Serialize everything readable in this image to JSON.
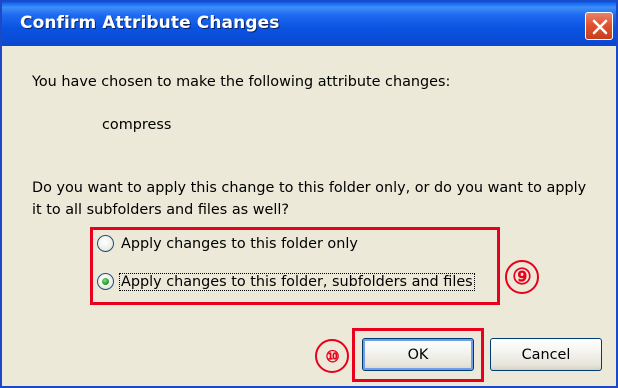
{
  "dialog": {
    "title": "Confirm Attribute Changes",
    "intro": "You have chosen to make the following attribute changes:",
    "attribute": "compress",
    "question": "Do you want to apply this change to this folder only, or do you want to apply it to all subfolders and files as well?",
    "options": [
      {
        "label": "Apply changes to this folder only",
        "selected": false
      },
      {
        "label": "Apply changes to this folder, subfolders and files",
        "selected": true
      }
    ],
    "ok_label": "OK",
    "cancel_label": "Cancel"
  },
  "annotations": {
    "marker_9": "⑨",
    "marker_10": "⑩"
  },
  "colors": {
    "titlebar": "#0a53e1",
    "dialog_bg": "#ece9d8",
    "annotation": "#e8001c",
    "close_button": "#e2532f",
    "radio_dot": "#2ea32e"
  }
}
